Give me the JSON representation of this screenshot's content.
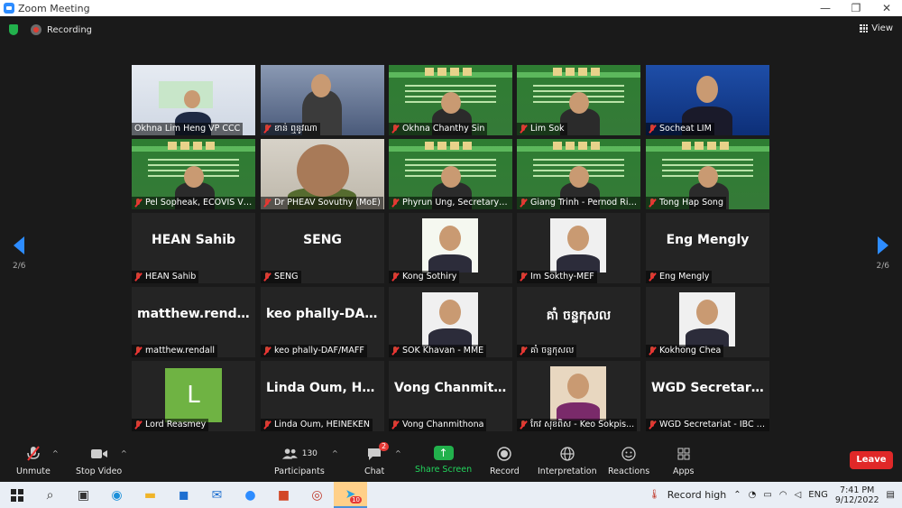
{
  "window": {
    "title": "Zoom Meeting",
    "min": "—",
    "max": "❐",
    "close": "✕"
  },
  "topbar": {
    "recording": "Recording",
    "view": "View"
  },
  "nav": {
    "page": "2/6"
  },
  "tiles": [
    {
      "label": "Okhna Lim Heng VP CCC",
      "big": "",
      "muted": false,
      "bg": "video-room"
    },
    {
      "label": "ខាន់ ឮនូវណា",
      "big": "",
      "muted": true,
      "bg": "video-speaker"
    },
    {
      "label": "Okhna Chanthy Sin",
      "big": "",
      "muted": true,
      "bg": "green"
    },
    {
      "label": "Lim Sok",
      "big": "",
      "muted": true,
      "bg": "green"
    },
    {
      "label": "Socheat LIM",
      "big": "",
      "muted": true,
      "bg": "blue"
    },
    {
      "label": "Pel Sopheak, ECOVIS VSDK",
      "big": "",
      "muted": true,
      "bg": "green"
    },
    {
      "label": "Dr PHEAV Sovuthy (MoE)",
      "big": "",
      "muted": true,
      "bg": "video-face"
    },
    {
      "label": "Phyrun Ung, Secretary of ...",
      "big": "",
      "muted": true,
      "bg": "green"
    },
    {
      "label": "Giang Trinh - Pernod Rica...",
      "big": "",
      "muted": true,
      "bg": "green"
    },
    {
      "label": "Tong Hap Song",
      "big": "",
      "muted": true,
      "bg": "green"
    },
    {
      "label": "HEAN Sahib",
      "big": "HEAN Sahib",
      "muted": true,
      "bg": "dark"
    },
    {
      "label": "SENG",
      "big": "SENG",
      "muted": true,
      "bg": "dark"
    },
    {
      "label": "Kong Sothiry",
      "big": "",
      "muted": true,
      "bg": "photo-woman"
    },
    {
      "label": "Im Sokthy-MEF",
      "big": "",
      "muted": true,
      "bg": "photo-man"
    },
    {
      "label": "Eng Mengly",
      "big": "Eng Mengly",
      "muted": true,
      "bg": "dark"
    },
    {
      "label": "matthew.rendall",
      "big": "matthew.rendall",
      "muted": true,
      "bg": "dark"
    },
    {
      "label": "keo phally-DAF/MAFF",
      "big": "keo phally-DAF...",
      "muted": true,
      "bg": "dark"
    },
    {
      "label": "SOK Khavan - MME",
      "big": "",
      "muted": true,
      "bg": "photo-man"
    },
    {
      "label": "គាំ ចន្ទកុសល",
      "big": "គាំ ចន្ទកុសល",
      "muted": true,
      "bg": "dark"
    },
    {
      "label": "Kokhong Chea",
      "big": "",
      "muted": true,
      "bg": "photo-man2"
    },
    {
      "label": "Lord Reasmey",
      "big": "L",
      "muted": true,
      "bg": "avatar"
    },
    {
      "label": "Linda Oum, HEINEKEN",
      "big": "Linda Oum, HEI...",
      "muted": true,
      "bg": "dark"
    },
    {
      "label": "Vong Chanmithona",
      "big": "Vong Chanmith...",
      "muted": true,
      "bg": "dark"
    },
    {
      "label": "កែវ សុខពិស - Keo Sokpis...",
      "big": "",
      "muted": true,
      "bg": "photo-woman2"
    },
    {
      "label": "WGD Secretariat - IBC - S...",
      "big": "WGD Secretaria...",
      "muted": true,
      "bg": "dark"
    }
  ],
  "toolbar": {
    "unmute": "Unmute",
    "stop_video": "Stop Video",
    "participants": "Participants",
    "participants_count": "130",
    "chat": "Chat",
    "chat_badge": "2",
    "share": "Share Screen",
    "record": "Record",
    "interpretation": "Interpretation",
    "reactions": "Reactions",
    "apps": "Apps",
    "leave": "Leave"
  },
  "taskbar": {
    "record_high": "Record high",
    "lang": "ENG",
    "time": "7:41 PM",
    "date": "9/12/2022",
    "telegram_badge": "10"
  },
  "colors": {
    "accent": "#2d8cff",
    "leave": "#e02828",
    "share": "#22b14c"
  }
}
